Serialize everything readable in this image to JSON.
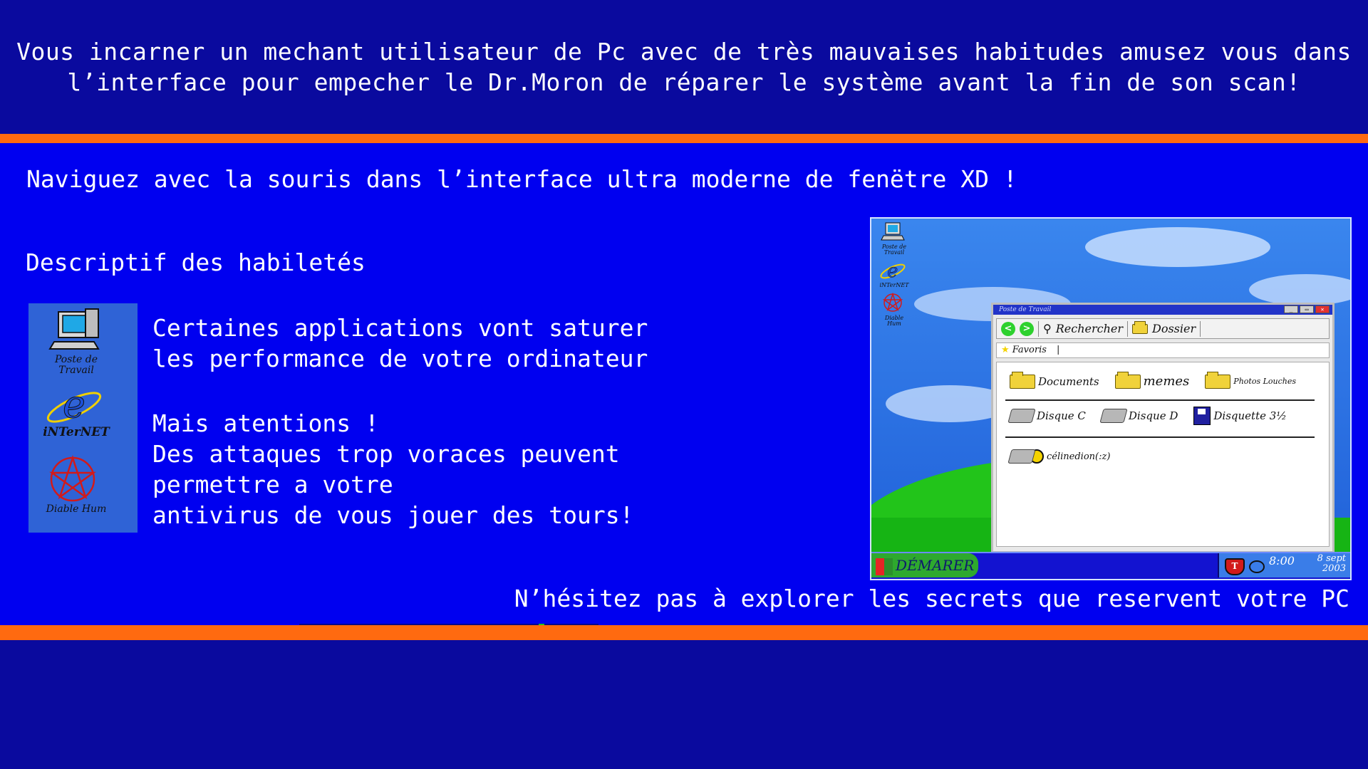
{
  "intro": {
    "line1": "Vous incarner un mechant utilisateur de Pc avec de très mauvaises habitudes amusez vous dans",
    "line2": "l’interface pour empecher le Dr.Moron de réparer le système avant la fin de son scan!"
  },
  "navigation_text": "Naviguez avec la souris dans l’interface ultra moderne de fenëtre XD !",
  "skills": {
    "title": "Descriptif des habiletés",
    "lines": [
      "Certaines applications vont saturer",
      "les performance de votre ordinateur",
      "Mais atentions !",
      "Des attaques trop voraces peuvent",
      "permettre a votre",
      "antivirus de vous jouer des tours!"
    ]
  },
  "icons": [
    {
      "name": "computer-icon",
      "label": "Poste de Travail"
    },
    {
      "name": "internet-icon",
      "label": "iNTerNET"
    },
    {
      "name": "pentagram-icon",
      "label": "Diable Hum"
    }
  ],
  "preview": {
    "desktop_icons": [
      "Poste de Travail",
      "iNTerNET",
      "Diable Hum"
    ],
    "window": {
      "title": "Poste de Travail",
      "search_label": "Rechercher",
      "folder_label": "Dossier",
      "favorites_label": "Favoris",
      "folders": [
        "Documents",
        "memes",
        "Photos Louches"
      ],
      "drives": [
        "Disque C",
        "Disque D",
        "Disquette 3½"
      ],
      "cd": "célinedion(:z)"
    },
    "taskbar": {
      "start_label": "DÉMARER",
      "time": "8:00",
      "date_line1": "8 sept",
      "date_line2": "2003"
    }
  },
  "footer_text": "N’hésitez pas à explorer les secrets que reservent votre PC",
  "colors": {
    "dark_blue": "#0a0a9e",
    "bright_blue": "#0000f0",
    "orange": "#ff6a10"
  }
}
